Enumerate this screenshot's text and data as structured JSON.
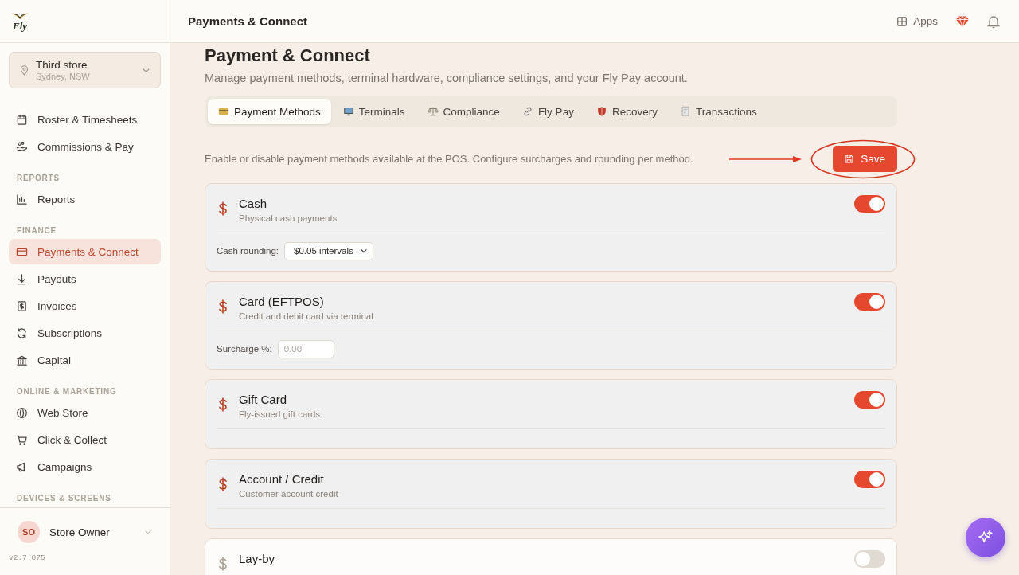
{
  "logo": {
    "text": "Fly"
  },
  "store": {
    "name": "Third store",
    "location": "Sydney, NSW"
  },
  "sidebar": {
    "sections": [
      {
        "items": [
          {
            "label": "Roster & Timesheets",
            "selected": false
          },
          {
            "label": "Commissions & Pay",
            "selected": false
          }
        ]
      },
      {
        "heading": "REPORTS",
        "items": [
          {
            "label": "Reports",
            "selected": false
          }
        ]
      },
      {
        "heading": "FINANCE",
        "items": [
          {
            "label": "Payments & Connect",
            "selected": true
          },
          {
            "label": "Payouts",
            "selected": false
          },
          {
            "label": "Invoices",
            "selected": false
          },
          {
            "label": "Subscriptions",
            "selected": false
          },
          {
            "label": "Capital",
            "selected": false
          }
        ]
      },
      {
        "heading": "ONLINE & MARKETING",
        "items": [
          {
            "label": "Web Store",
            "selected": false
          },
          {
            "label": "Click & Collect",
            "selected": false
          },
          {
            "label": "Campaigns",
            "selected": false
          }
        ]
      },
      {
        "heading": "DEVICES & SCREENS"
      }
    ]
  },
  "user": {
    "initials": "SO",
    "name": "Store Owner"
  },
  "version": "v2.7.875",
  "header": {
    "title": "Payments & Connect",
    "apps": "Apps"
  },
  "page": {
    "title": "Payment & Connect",
    "subtitle": "Manage payment methods, terminal hardware, compliance settings, and your Fly Pay account."
  },
  "tabs": [
    {
      "label": "Payment Methods",
      "selected": true
    },
    {
      "label": "Terminals",
      "selected": false
    },
    {
      "label": "Compliance",
      "selected": false
    },
    {
      "label": "Fly Pay",
      "selected": false
    },
    {
      "label": "Recovery",
      "selected": false
    },
    {
      "label": "Transactions",
      "selected": false
    }
  ],
  "intro": "Enable or disable payment methods available at the POS. Configure surcharges and rounding per method.",
  "save": "Save",
  "methods": [
    {
      "name": "Cash",
      "description": "Physical cash payments",
      "enabled": true,
      "setting": {
        "kind": "select",
        "label": "Cash rounding:",
        "value": "$0.05 intervals"
      }
    },
    {
      "name": "Card (EFTPOS)",
      "description": "Credit and debit card via terminal",
      "enabled": true,
      "setting": {
        "kind": "input",
        "label": "Surcharge %:",
        "placeholder": "0.00"
      }
    },
    {
      "name": "Gift Card",
      "description": "Fly-issued gift cards",
      "enabled": true
    },
    {
      "name": "Account / Credit",
      "description": "Customer account credit",
      "enabled": true
    },
    {
      "name": "Lay-by",
      "enabled": false
    }
  ]
}
